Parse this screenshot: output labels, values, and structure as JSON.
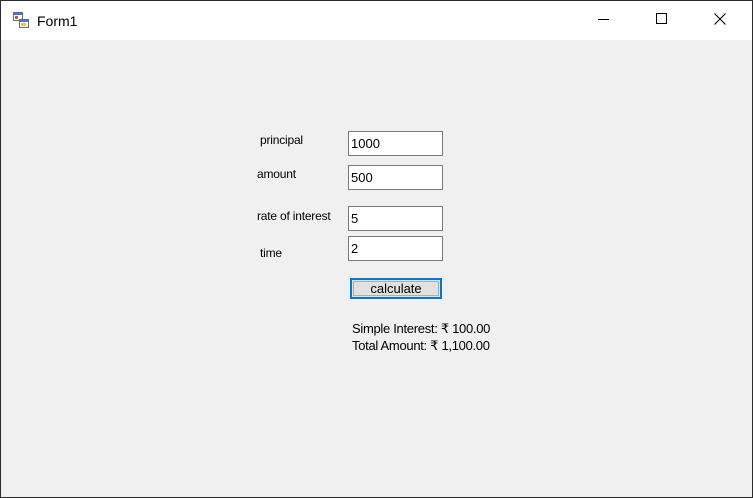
{
  "window": {
    "title": "Form1",
    "icon": "winforms-app-icon",
    "controls": {
      "minimize_icon": "minimize-icon",
      "maximize_icon": "maximize-icon",
      "close_icon": "close-icon"
    }
  },
  "form": {
    "principal": {
      "label": "principal",
      "value": "1000"
    },
    "amount": {
      "label": "amount",
      "value": "500"
    },
    "rate": {
      "label": "rate of interest",
      "value": "5"
    },
    "time": {
      "label": "time",
      "value": "2"
    },
    "calculate_label": "calculate"
  },
  "results": {
    "simple_interest": "Simple Interest: ₹ 100.00",
    "total_amount": "Total Amount: ₹ 1,100.00"
  },
  "colors": {
    "form_background": "#f0f0f0",
    "titlebar_background": "#ffffff",
    "button_focus_border": "#0078d7"
  }
}
